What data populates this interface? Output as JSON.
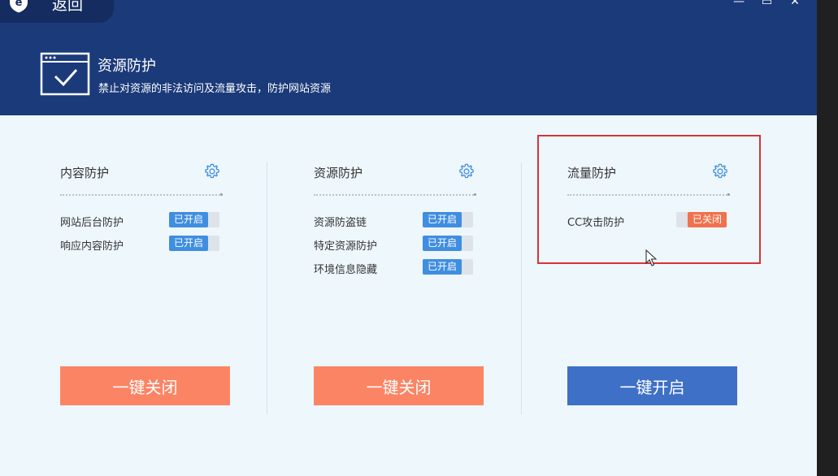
{
  "titlebar": {
    "back_label": "返回",
    "logo_letter": "e",
    "controls": [
      "—",
      "▭",
      "✕"
    ]
  },
  "header": {
    "title": "资源防护",
    "subtitle": "禁止对资源的非法访问及流量攻击，防护网站资源"
  },
  "cards": [
    {
      "title": "内容防护",
      "items": [
        {
          "label": "网站后台防护",
          "status": "已开启",
          "enabled": true
        },
        {
          "label": "响应内容防护",
          "status": "已开启",
          "enabled": true
        }
      ],
      "button": "一键关闭"
    },
    {
      "title": "资源防护",
      "items": [
        {
          "label": "资源防盗链",
          "status": "已开启",
          "enabled": true
        },
        {
          "label": "特定资源防护",
          "status": "已开启",
          "enabled": true
        },
        {
          "label": "环境信息隐藏",
          "status": "已开启",
          "enabled": true
        }
      ],
      "button": "一键关闭"
    },
    {
      "title": "流量防护",
      "items": [
        {
          "label": "CC攻击防护",
          "status": "已关闭",
          "enabled": false
        }
      ],
      "button": "一键开启"
    }
  ],
  "colors": {
    "header_bg": "#1b3a7a",
    "body_bg": "#eef7fc",
    "toggle_on": "#3f8ee0",
    "toggle_off": "#f2714d",
    "button_off": "#fb8465",
    "button_on": "#3d70c6",
    "highlight_border": "#d9323a"
  },
  "icons": {
    "logo": "shield-e-icon",
    "header": "browser-check-icon",
    "settings": "gear-icon",
    "cursor": "mouse-pointer-icon"
  }
}
